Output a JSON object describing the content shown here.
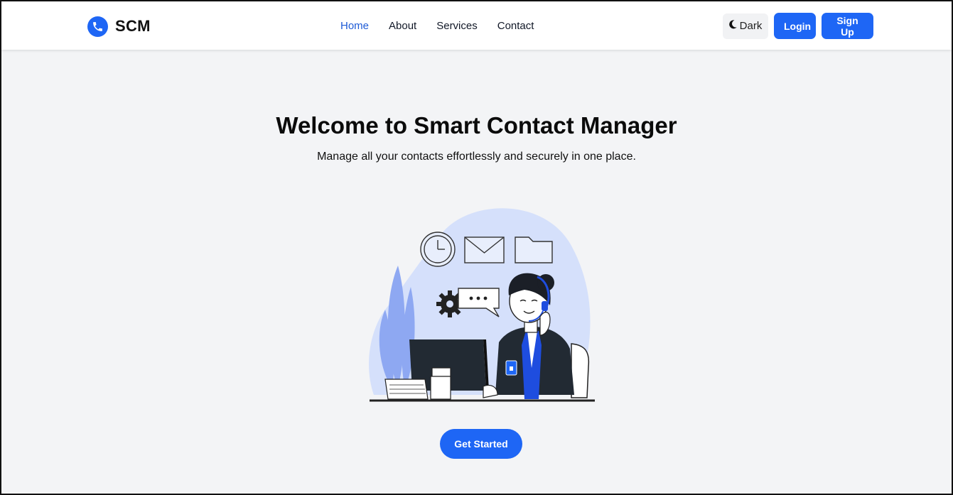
{
  "brand": {
    "name": "SCM",
    "icon": "phone-icon",
    "color": "#1e66f5"
  },
  "nav": {
    "links": [
      {
        "label": "Home",
        "active": true
      },
      {
        "label": "About",
        "active": false
      },
      {
        "label": "Services",
        "active": false
      },
      {
        "label": "Contact",
        "active": false
      }
    ],
    "theme_toggle_label": "Dark",
    "theme_toggle_icon": "moon-icon",
    "login_label": "Login",
    "signup_label": "Sign Up"
  },
  "hero": {
    "title": "Welcome to Smart Contact Manager",
    "subtitle": "Manage all your contacts effortlessly and securely in one place.",
    "cta_label": "Get Started"
  },
  "colors": {
    "primary": "#1e66f5",
    "active_link": "#1e5bd6",
    "background": "#f3f4f6",
    "illustration_blob": "#d5e0fb"
  }
}
